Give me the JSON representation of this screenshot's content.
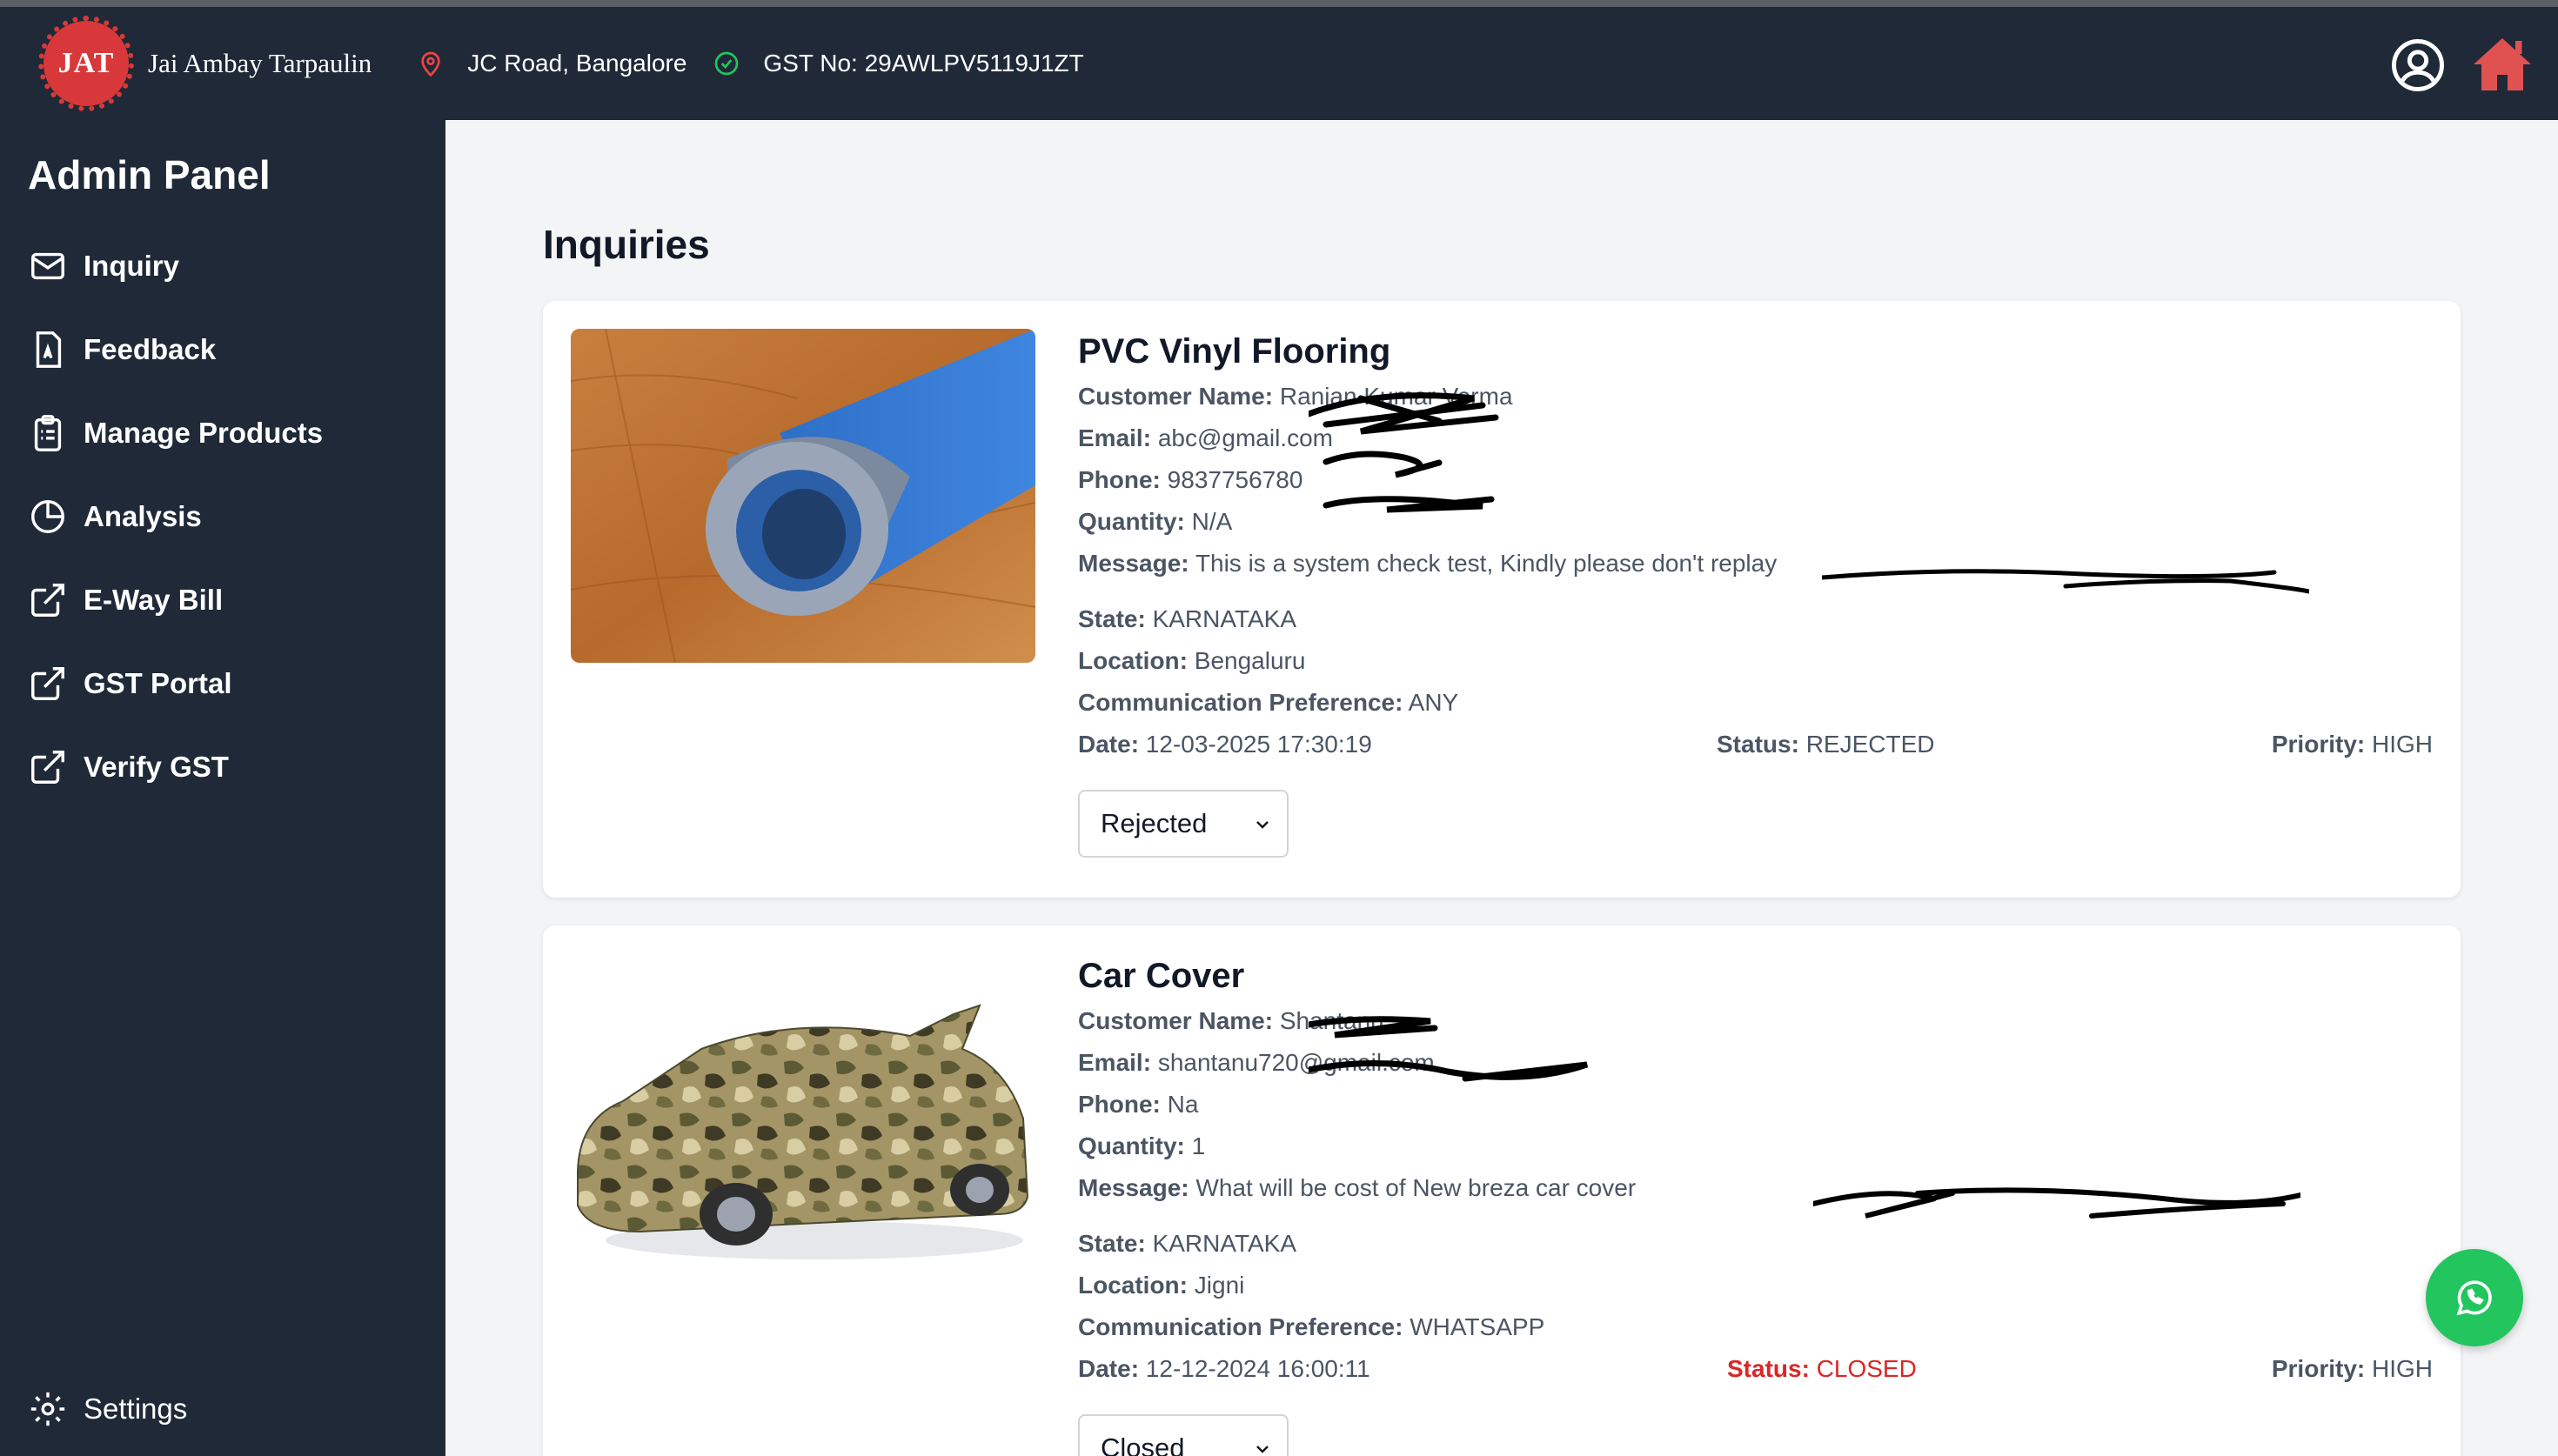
{
  "header": {
    "logo_text": "JAT",
    "brand_name": "Jai Ambay Tarpaulin",
    "location": "JC Road, Bangalore",
    "gst": "GST No: 29AWLPV5119J1ZT"
  },
  "sidebar": {
    "title": "Admin Panel",
    "items": [
      {
        "label": "Inquiry",
        "icon": "mail-icon"
      },
      {
        "label": "Feedback",
        "icon": "feedback-doc-icon"
      },
      {
        "label": "Manage Products",
        "icon": "clipboard-list-icon"
      },
      {
        "label": "Analysis",
        "icon": "pie-chart-icon"
      },
      {
        "label": "E-Way Bill",
        "icon": "external-link-icon"
      },
      {
        "label": "GST Portal",
        "icon": "external-link-icon"
      },
      {
        "label": "Verify GST",
        "icon": "external-link-icon"
      }
    ],
    "settings_label": "Settings"
  },
  "main": {
    "title": "Inquiries"
  },
  "labels": {
    "customer_name": "Customer Name:",
    "email": "Email:",
    "phone": "Phone:",
    "quantity": "Quantity:",
    "message": "Message:",
    "state": "State:",
    "location": "Location:",
    "comm_pref": "Communication Preference:",
    "date": "Date:",
    "status": "Status:",
    "priority": "Priority:"
  },
  "inquiries": [
    {
      "product": "PVC Vinyl Flooring",
      "customer_name": "Ranjan Kumar Verma",
      "email": "abc@gmail.com",
      "phone": "9837756780",
      "quantity": "N/A",
      "message": "This is a system check test, Kindly please don't replay",
      "state": "KARNATAKA",
      "location": "Bengaluru",
      "comm_pref": "ANY",
      "date": "12-03-2025 17:30:19",
      "status": "REJECTED",
      "priority": "HIGH",
      "select_value": "Rejected"
    },
    {
      "product": "Car Cover",
      "customer_name": "Shantanu",
      "email": "shantanu720@gmail.com",
      "phone": "Na",
      "quantity": "1",
      "message": "What will be cost of New breza car cover",
      "state": "KARNATAKA",
      "location": "Jigni",
      "comm_pref": "WHATSAPP",
      "date": "12-12-2024 16:00:11",
      "status": "CLOSED",
      "priority": "HIGH",
      "select_value": "Closed"
    }
  ],
  "colors": {
    "dark_bg": "#1f2937",
    "brand_red": "#d9383a",
    "status_closed": "#dc2626",
    "whatsapp": "#22c55e"
  }
}
